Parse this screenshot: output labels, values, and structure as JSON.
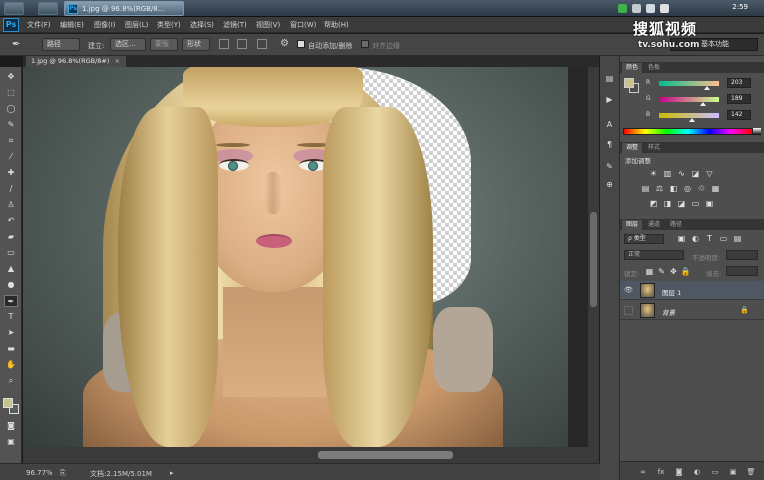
{
  "taskbar": {
    "task_label": "1.jpg @ 96.8%(RGB/8...",
    "clock": "2:59",
    "tray_icons": [
      "shield-icon",
      "network-icon",
      "volume-icon",
      "flag-icon"
    ]
  },
  "watermark": {
    "title": "搜狐视频",
    "url": "tv.sohu.com"
  },
  "app": {
    "logo": "Ps",
    "menus": [
      "文件(F)",
      "编辑(E)",
      "图像(I)",
      "图层(L)",
      "类型(Y)",
      "选择(S)",
      "滤镜(T)",
      "视图(V)",
      "窗口(W)",
      "帮助(H)"
    ]
  },
  "options": {
    "tool_icon": "pen-icon",
    "mode_value": "路径",
    "make_label": "建立:",
    "selection_button": "选区...",
    "mask_button": "蒙版",
    "shape_button": "形状",
    "auto_add_delete": "自动添加/删除",
    "align_edges": "对齐边缘",
    "workspace": "基本功能"
  },
  "document": {
    "tab_title": "1.jpg @ 96.8%(RGB/8#)",
    "zoom": "96.77%",
    "doc_info": "文档:2.15M/5.01M"
  },
  "tools": [
    "move-tool-icon",
    "marquee-tool-icon",
    "lasso-tool-icon",
    "quick-select-tool-icon",
    "crop-tool-icon",
    "eyedropper-tool-icon",
    "healing-brush-tool-icon",
    "brush-tool-icon",
    "clone-stamp-tool-icon",
    "history-brush-tool-icon",
    "eraser-tool-icon",
    "gradient-tool-icon",
    "blur-tool-icon",
    "dodge-tool-icon",
    "pen-tool-icon",
    "type-tool-icon",
    "path-select-tool-icon",
    "shape-tool-icon",
    "hand-tool-icon",
    "zoom-tool-icon"
  ],
  "color_panel": {
    "tabs": [
      "颜色",
      "色板"
    ],
    "channels": [
      {
        "label": "R",
        "value": "203",
        "fraction": 0.796
      },
      {
        "label": "G",
        "value": "189",
        "fraction": 0.741
      },
      {
        "label": "B",
        "value": "142",
        "fraction": 0.557
      }
    ],
    "foreground_color": "#cbbd8e"
  },
  "adjustments_panel": {
    "tabs": [
      "调整",
      "样式"
    ],
    "header": "添加调整"
  },
  "layers_panel": {
    "tabs": [
      "图层",
      "通道",
      "路径"
    ],
    "filter_label": "ρ 类型",
    "blend_mode": "正常",
    "opacity_label": "不透明度:",
    "lock_label": "锁定:",
    "fill_label": "填充:",
    "layers": [
      {
        "name": "图层 1",
        "visible": true,
        "locked": false,
        "selected": true
      },
      {
        "name": "背景",
        "visible": false,
        "locked": true,
        "selected": false
      }
    ]
  }
}
